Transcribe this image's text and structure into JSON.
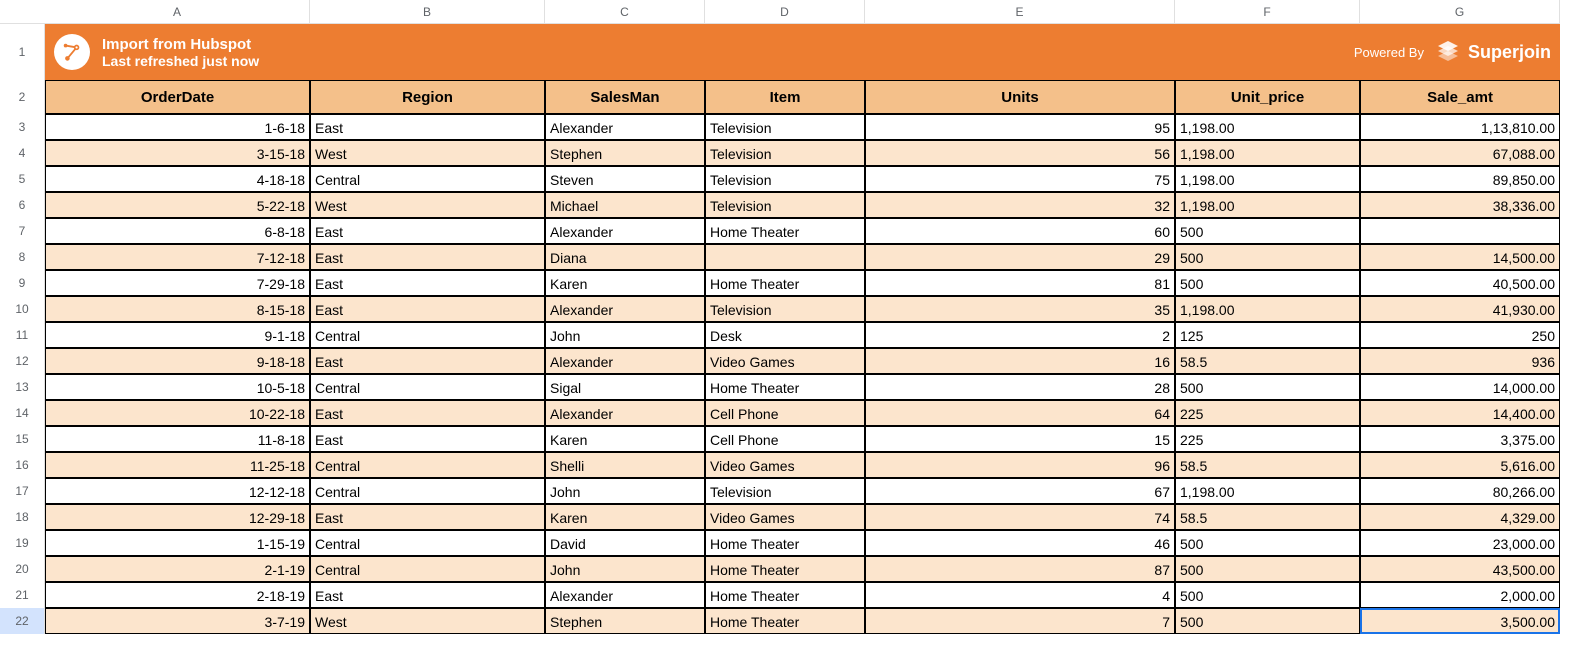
{
  "columns": [
    "A",
    "B",
    "C",
    "D",
    "E",
    "F",
    "G"
  ],
  "rowNumbers": [
    1,
    2,
    3,
    4,
    5,
    6,
    7,
    8,
    9,
    10,
    11,
    12,
    13,
    14,
    15,
    16,
    17,
    18,
    19,
    20,
    21,
    22
  ],
  "banner": {
    "title": "Import from Hubspot",
    "subtitle": "Last refreshed just now",
    "poweredBy": "Powered By",
    "brand": "Superjoin"
  },
  "headers": {
    "A": "OrderDate",
    "B": "Region",
    "C": "SalesMan",
    "D": "Item",
    "E": "Units",
    "F": "Unit_price",
    "G": "Sale_amt"
  },
  "rows": [
    {
      "date": "1-6-18",
      "region": "East",
      "sales": "Alexander",
      "item": "Television",
      "units": "95",
      "price": "1,198.00",
      "amt": "1,13,810.00"
    },
    {
      "date": "3-15-18",
      "region": "West",
      "sales": "Stephen",
      "item": "Television",
      "units": "56",
      "price": "1,198.00",
      "amt": "67,088.00"
    },
    {
      "date": "4-18-18",
      "region": "Central",
      "sales": "Steven",
      "item": "Television",
      "units": "75",
      "price": "1,198.00",
      "amt": "89,850.00"
    },
    {
      "date": "5-22-18",
      "region": "West",
      "sales": "Michael",
      "item": "Television",
      "units": "32",
      "price": "1,198.00",
      "amt": "38,336.00"
    },
    {
      "date": "6-8-18",
      "region": "East",
      "sales": "Alexander",
      "item": "Home Theater",
      "units": "60",
      "price": "500",
      "amt": ""
    },
    {
      "date": "7-12-18",
      "region": "East",
      "sales": "Diana",
      "item": "",
      "units": "29",
      "price": "500",
      "amt": "14,500.00"
    },
    {
      "date": "7-29-18",
      "region": "East",
      "sales": "Karen",
      "item": "Home Theater",
      "units": "81",
      "price": "500",
      "amt": "40,500.00"
    },
    {
      "date": "8-15-18",
      "region": "East",
      "sales": "Alexander",
      "item": "Television",
      "units": "35",
      "price": "1,198.00",
      "amt": "41,930.00"
    },
    {
      "date": "9-1-18",
      "region": "Central",
      "sales": "John",
      "item": "Desk",
      "units": "2",
      "price": "125",
      "amt": "250"
    },
    {
      "date": "9-18-18",
      "region": "East",
      "sales": "Alexander",
      "item": "Video Games",
      "units": "16",
      "price": "58.5",
      "amt": "936"
    },
    {
      "date": "10-5-18",
      "region": "Central",
      "sales": "Sigal",
      "item": "Home Theater",
      "units": "28",
      "price": "500",
      "amt": "14,000.00"
    },
    {
      "date": "10-22-18",
      "region": "East",
      "sales": "Alexander",
      "item": "Cell Phone",
      "units": "64",
      "price": "225",
      "amt": "14,400.00"
    },
    {
      "date": "11-8-18",
      "region": "East",
      "sales": "Karen",
      "item": "Cell Phone",
      "units": "15",
      "price": "225",
      "amt": "3,375.00"
    },
    {
      "date": "11-25-18",
      "region": "Central",
      "sales": "Shelli",
      "item": "Video Games",
      "units": "96",
      "price": "58.5",
      "amt": "5,616.00"
    },
    {
      "date": "12-12-18",
      "region": "Central",
      "sales": "John",
      "item": "Television",
      "units": "67",
      "price": "1,198.00",
      "amt": "80,266.00"
    },
    {
      "date": "12-29-18",
      "region": "East",
      "sales": "Karen",
      "item": "Video Games",
      "units": "74",
      "price": "58.5",
      "amt": "4,329.00"
    },
    {
      "date": "1-15-19",
      "region": "Central",
      "sales": "David",
      "item": "Home Theater",
      "units": "46",
      "price": "500",
      "amt": "23,000.00"
    },
    {
      "date": "2-1-19",
      "region": "Central",
      "sales": "John",
      "item": "Home Theater",
      "units": "87",
      "price": "500",
      "amt": "43,500.00"
    },
    {
      "date": "2-18-19",
      "region": "East",
      "sales": "Alexander",
      "item": "Home Theater",
      "units": "4",
      "price": "500",
      "amt": "2,000.00"
    },
    {
      "date": "3-7-19",
      "region": "West",
      "sales": "Stephen",
      "item": "Home Theater",
      "units": "7",
      "price": "500",
      "amt": "3,500.00"
    }
  ],
  "selectedRow": 22
}
